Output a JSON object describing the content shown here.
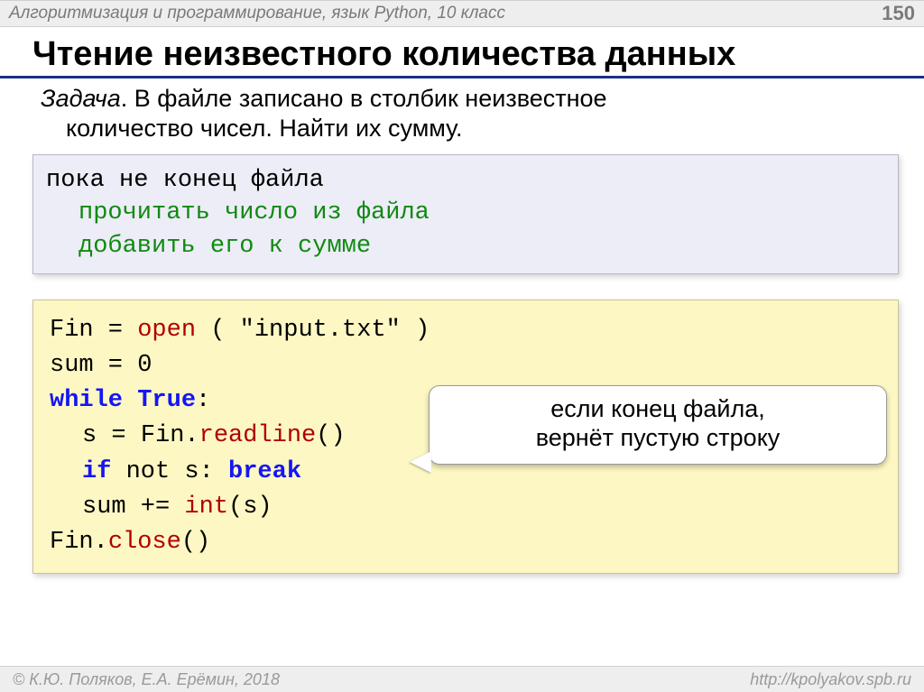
{
  "header": {
    "course": "Алгоритмизация и программирование, язык Python, 10 класс",
    "page": "150"
  },
  "title": "Чтение неизвестного количества данных",
  "task": {
    "label": "Задача",
    "line1_after": ". В файле записано в столбик неизвестное",
    "line2": "количество чисел. Найти их сумму."
  },
  "pseudo": {
    "l1": "пока не конец файла",
    "l2": "прочитать число из файла",
    "l3": "добавить его к сумме"
  },
  "code": {
    "l1_a": "Fin",
    "l1_eq": " = ",
    "l1_open": "open",
    "l1_b": " ( \"input.txt\" )",
    "l2_a": "sum",
    "l2_eq": " = ",
    "l2_b": "0",
    "l3_while": "while",
    "l3_sp": " ",
    "l3_true": "True",
    "l3_colon": ":",
    "l4_a": "s",
    "l4_eq": " = ",
    "l4_b": "Fin.",
    "l4_read": "readline",
    "l4_c": "()",
    "l5_if": "if",
    "l5_mid": " not s: ",
    "l5_break": "break",
    "l6_a": "sum",
    "l6_eq": " += ",
    "l6_int": "int",
    "l6_b": "(s)",
    "l7_a": "Fin.",
    "l7_close": "close",
    "l7_b": "()"
  },
  "callout": {
    "l1": "если конец файла,",
    "l2": "вернёт пустую строку"
  },
  "footer": {
    "copyright": "© К.Ю. Поляков, Е.А. Ерёмин, 2018",
    "url": "http://kpolyakov.spb.ru"
  }
}
